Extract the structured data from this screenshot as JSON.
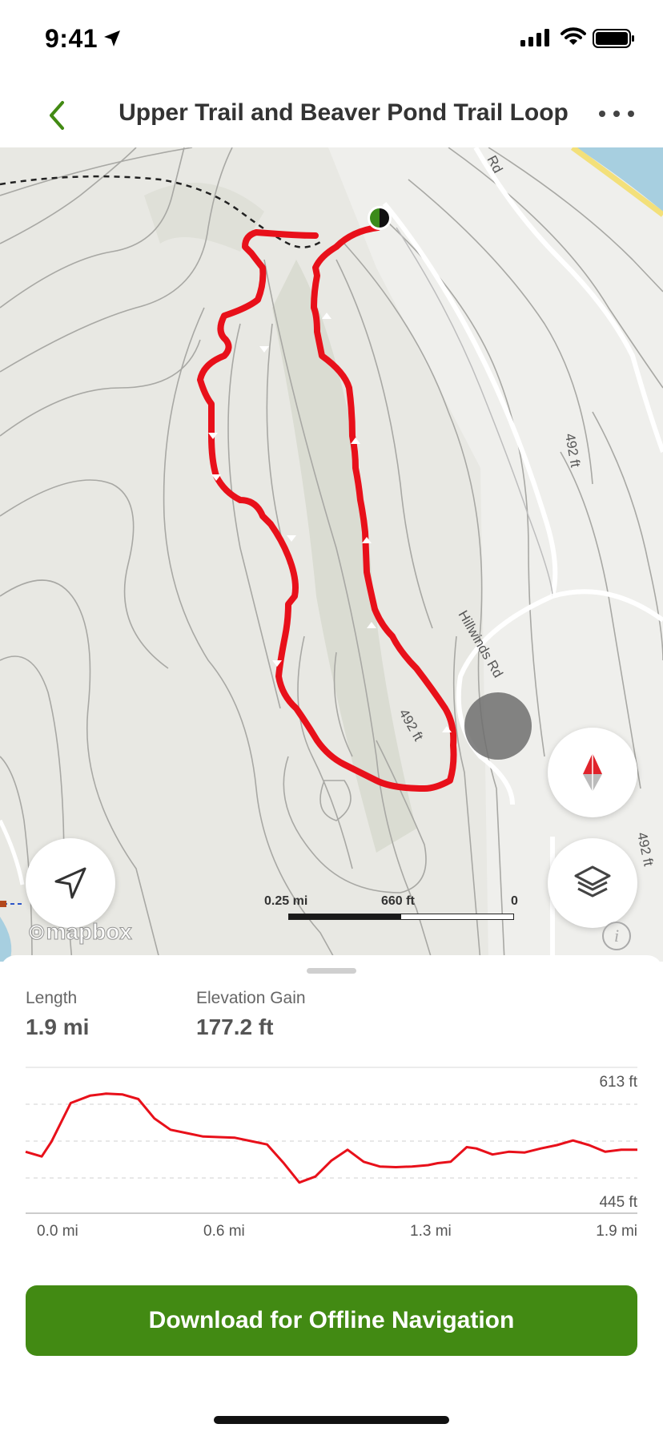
{
  "status_bar": {
    "time": "9:41",
    "icons": [
      "location-arrow-icon",
      "signal-icon",
      "wifi-icon",
      "battery-icon"
    ]
  },
  "header": {
    "title": "Upper Trail and Beaver Pond Trail Loop",
    "back_icon": "chevron-left-icon",
    "more_icon": "ellipsis-icon",
    "accent_color": "#428a13"
  },
  "map": {
    "road_labels": [
      "Rd",
      "492 ft",
      "Hillwinds Rd",
      "492 ft",
      "492 ft"
    ],
    "scale": {
      "left_label": "0.25 mi",
      "mid_label": "660 ft",
      "right_label": "0"
    },
    "attribution": "mapbox",
    "trail_color": "#e8101a",
    "buttons": [
      "compass-icon",
      "layers-icon",
      "locate-icon",
      "info-icon"
    ]
  },
  "stats": {
    "length_label": "Length",
    "length_value": "1.9 mi",
    "gain_label": "Elevation Gain",
    "gain_value": "177.2 ft"
  },
  "chart_data": {
    "type": "line",
    "title": "",
    "xlabel": "",
    "ylabel": "",
    "x_tick_labels": [
      "0.0 mi",
      "0.6 mi",
      "1.3 mi",
      "1.9 mi"
    ],
    "y_tick_labels": [
      "613 ft",
      "445 ft"
    ],
    "xlim": [
      0,
      1.9
    ],
    "ylim": [
      445,
      613
    ],
    "grid": true,
    "series": [
      {
        "color": "#e8101a",
        "x": [
          0.0,
          0.05,
          0.08,
          0.14,
          0.2,
          0.25,
          0.3,
          0.35,
          0.4,
          0.45,
          0.5,
          0.55,
          0.6,
          0.65,
          0.7,
          0.75,
          0.8,
          0.85,
          0.9,
          0.95,
          1.0,
          1.05,
          1.1,
          1.15,
          1.2,
          1.25,
          1.28,
          1.32,
          1.37,
          1.4,
          1.45,
          1.5,
          1.55,
          1.6,
          1.65,
          1.7,
          1.75,
          1.8,
          1.85,
          1.9
        ],
        "y": [
          525,
          518,
          540,
          598,
          609,
          612,
          611,
          604,
          575,
          558,
          553,
          548,
          547,
          546,
          541,
          536,
          509,
          479,
          488,
          512,
          528,
          510,
          503,
          502,
          503,
          505,
          508,
          510,
          532,
          530,
          521,
          525,
          524,
          530,
          535,
          542,
          535,
          525,
          528,
          528
        ]
      }
    ]
  }
}
